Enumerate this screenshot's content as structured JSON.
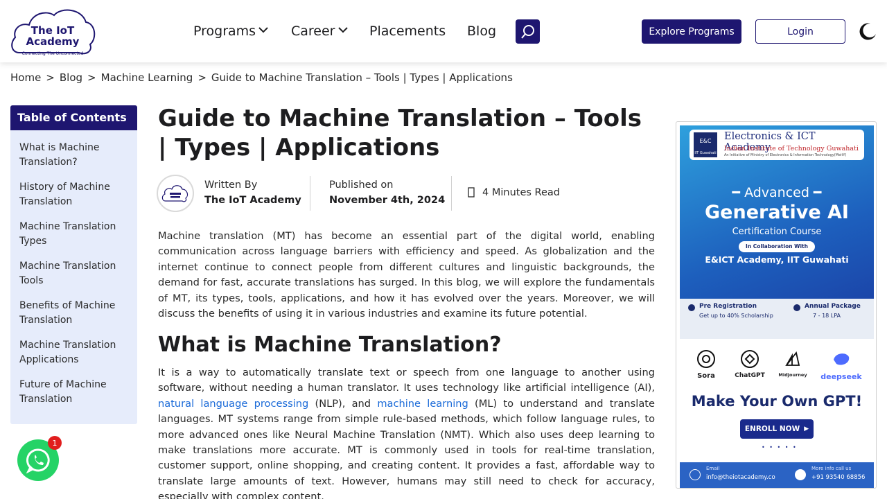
{
  "header": {
    "logo": {
      "line1": "The IoT",
      "line2": "Academy",
      "tagline": "Connecting The Unconnected"
    },
    "nav": [
      {
        "label": "Programs",
        "has_dropdown": true
      },
      {
        "label": "Career",
        "has_dropdown": true
      },
      {
        "label": "Placements",
        "has_dropdown": false
      },
      {
        "label": "Blog",
        "has_dropdown": false
      }
    ],
    "search_icon": "search-icon",
    "explore_label": "Explore Programs",
    "login_label": "Login",
    "theme_icon": "moon-icon",
    "brand_color": "#1e1670"
  },
  "breadcrumb": [
    "Home",
    ">",
    "Blog",
    ">",
    "Machine Learning",
    ">",
    "Guide to Machine Translation – Tools | Types | Applications"
  ],
  "toc": {
    "title": "Table of Contents",
    "items": [
      "What is Machine Translation?",
      "History of Machine Translation",
      "Machine Translation Types",
      "Machine Translation Tools",
      "Benefits of Machine Translation",
      "Machine Translation Applications",
      "Future of Machine Translation"
    ]
  },
  "article": {
    "title": "Guide to Machine Translation – Tools | Types | Applications",
    "written_by_label": "Written By",
    "author": "The IoT Academy",
    "published_label": "Published on",
    "published_date": "November 4th, 2024",
    "read_time": "4 Minutes Read",
    "intro": "Machine translation (MT) has become an essential part of the digital world, enabling communication across language barriers with efficiency and speed. As globalization and the internet continue to connect people from different cultures and linguistic backgrounds, the demand for fast, accurate translations has surged. In this blog, we will explore the fundamentals of MT, its types, tools, applications, and how it has evolved over the years. Moreover, we will discuss the benefits of using it in various industries and examine its future potential.",
    "h2": "What is Machine Translation?",
    "p2_a": "It is a way to automatically translate text or speech from one language to another using software, without needing a human translator. It uses technology like artificial intelligence (AI), ",
    "p2_link1": "natural language processing",
    "p2_b": " (NLP), and ",
    "p2_link2": "machine learning",
    "p2_c": " (ML) to understand and translate languages. MT systems range from simple rule-based methods, which follow language rules, to more advanced ones like Neural Machine Translation (NMT). Which also uses deep learning to make translations more accurate. MT is commonly used in tools for real-time translation, customer support, online shopping, and creating content. It provides a fast, affordable way to translate large amounts of text. However, humans may still need to check for accuracy, especially with complex content."
  },
  "ad": {
    "org_line1": "Electronics & ICT Academy",
    "org_line2": "Indian Institute of Technology Guwahati",
    "org_line3": "An Initiative of Ministry of Electronics & Information Technology(MeitY)",
    "logo_label": "E&C",
    "logo_sub": "IIT Guwahati",
    "eyebrow": "Advanced",
    "headline": "Generative AI",
    "course": "Certification Course",
    "collab_label": "In Collaboration With",
    "collab_org": "E&ICT Academy, IIT Guwahati",
    "pre_reg_title": "Pre Registration",
    "pre_reg_sub": "Get up to 40% Scholarship",
    "package_title": "Annual Package",
    "package_sub": "7 - 18 LPA",
    "tools": [
      "Sora",
      "ChatGPT",
      "Midjourney",
      "deepseek"
    ],
    "cta_headline": "Make Your Own GPT!",
    "enroll_label": "ENROLL NOW",
    "email_label": "Email",
    "email": "info@theiotacademy.co",
    "phone_label": "More info call us",
    "phone": "+91 93540 68856"
  },
  "whatsapp": {
    "icon": "whatsapp-icon",
    "badge": "1"
  }
}
